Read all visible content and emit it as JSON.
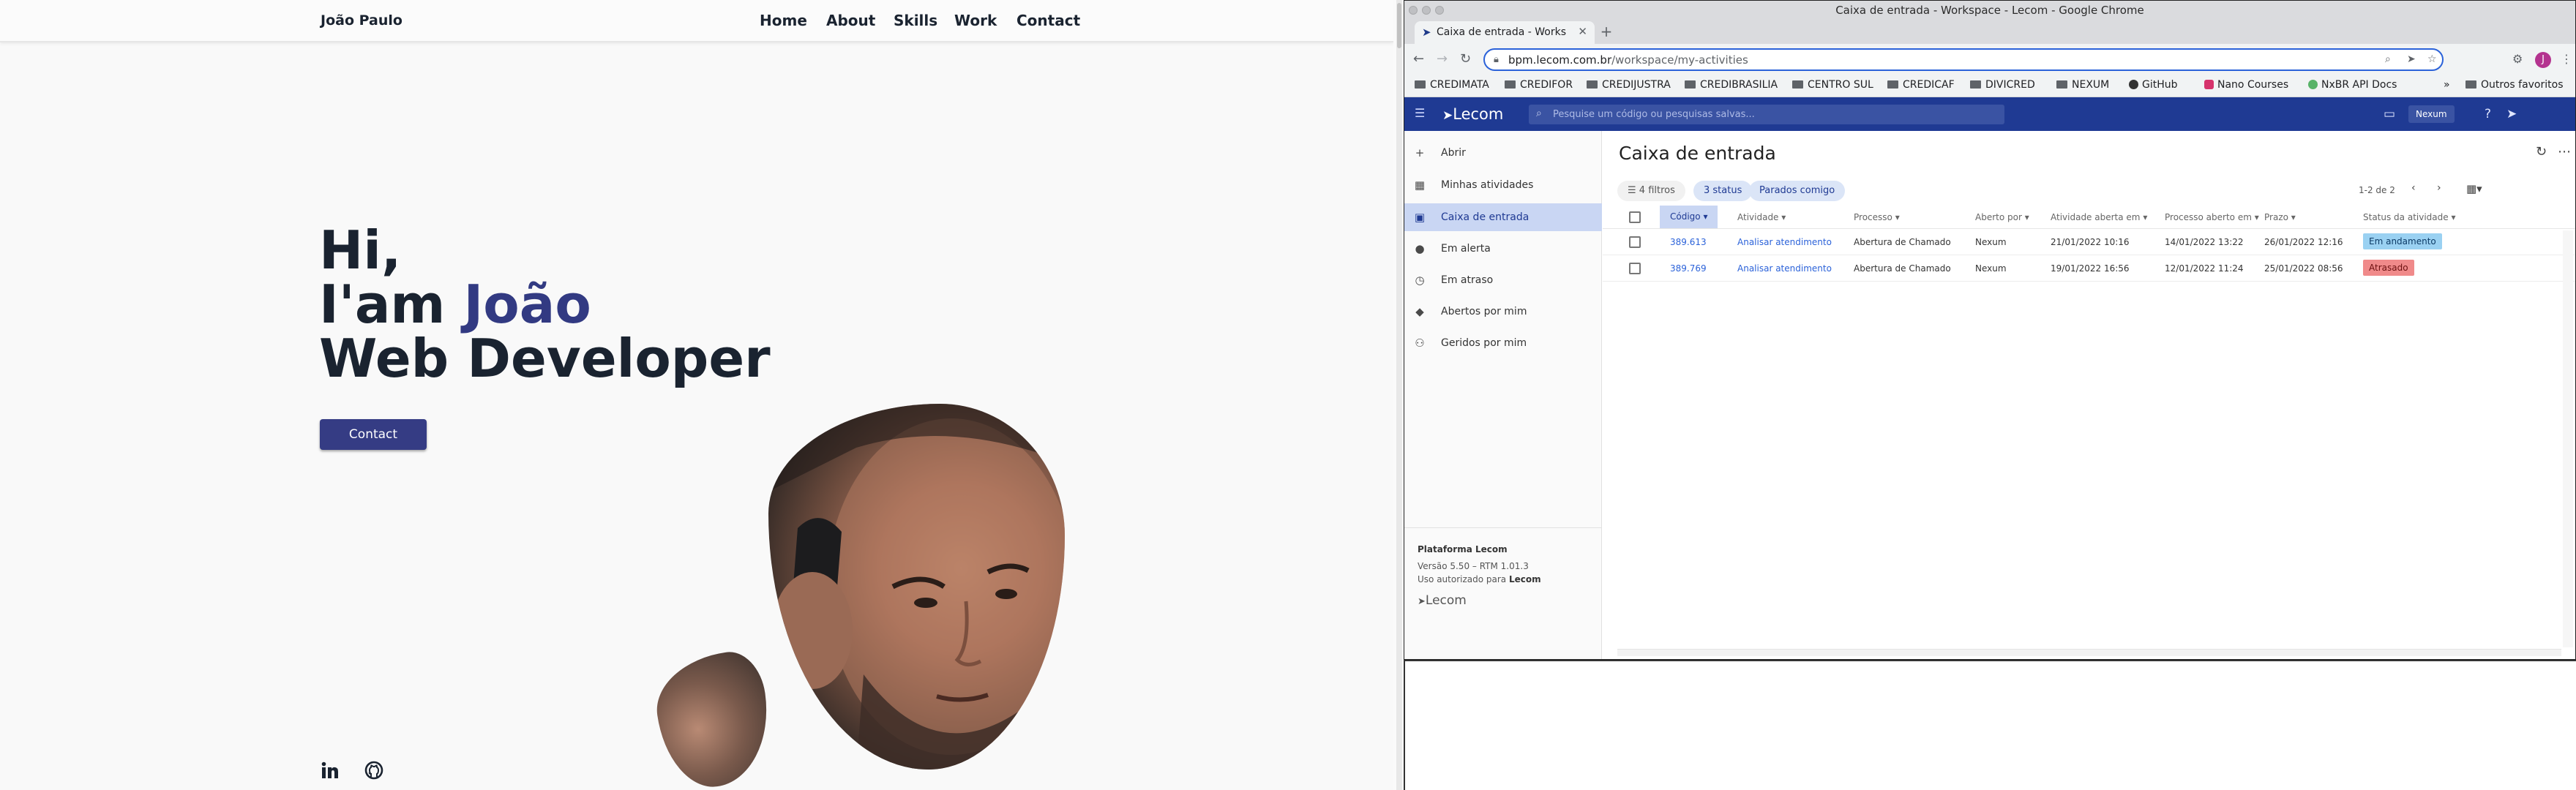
{
  "portfolio": {
    "brand": "João Paulo",
    "nav": [
      "Home",
      "About",
      "Skills",
      "Work",
      "Contact"
    ],
    "hero": {
      "line1": "Hi,",
      "line2_prefix": "I'am ",
      "line2_accent": "João",
      "line3": "Web Developer"
    },
    "cta_label": "Contact",
    "social": [
      "linkedin-icon",
      "github-icon"
    ],
    "accent_color": "#323a82"
  },
  "browser": {
    "window_title": "Caixa de entrada - Workspace - Lecom - Google Chrome",
    "tab_title": "Caixa de entrada - Worksp",
    "url_host": "bpm.lecom.com.br",
    "url_path": "/workspace/my-activities",
    "bookmarks": [
      "CREDIMATA",
      "CREDIFOR",
      "CREDIJUSTRA",
      "CREDIBRASILIA",
      "CENTRO SUL",
      "CREDICAF",
      "DIVICRED",
      "NEXUM",
      "GitHub",
      "Nano Courses",
      "NxBR API Docs"
    ],
    "bookmarks_more": "»",
    "other_bookmarks": "Outros favoritos",
    "avatar_letter": "J"
  },
  "app": {
    "logo": "Lecom",
    "search_placeholder": "Pesquise um código ou pesquisas salvas...",
    "user_chip": "Nexum",
    "sidebar": [
      {
        "label": "Abrir",
        "icon": "plus-icon",
        "active": false
      },
      {
        "label": "Minhas atividades",
        "icon": "grid-icon",
        "active": false
      },
      {
        "label": "Caixa de entrada",
        "icon": "inbox-icon",
        "active": true
      },
      {
        "label": "Em alerta",
        "icon": "alert-icon",
        "active": false
      },
      {
        "label": "Em atraso",
        "icon": "clock-icon",
        "active": false
      },
      {
        "label": "Abertos por mim",
        "icon": "tag-icon",
        "active": false
      },
      {
        "label": "Geridos por mim",
        "icon": "people-icon",
        "active": false
      }
    ],
    "footer": {
      "platform": "Plataforma Lecom",
      "version": "Versão 5.50 – RTM 1.01.3",
      "license_prefix": "Uso autorizado para ",
      "license_org": "Lecom",
      "logo": "Lecom"
    },
    "page_title": "Caixa de entrada",
    "filters": [
      "4 filtros",
      "3 status",
      "Parados comigo"
    ],
    "pager": "1-2 de 2",
    "columns": [
      "Código",
      "Atividade",
      "Processo",
      "Aberto por",
      "Atividade aberta em",
      "Processo aberto em",
      "Prazo",
      "Status da atividade"
    ],
    "rows": [
      {
        "codigo": "389.613",
        "atividade": "Analisar atendimento",
        "processo": "Abertura de Chamado",
        "aberto_por": "Nexum",
        "atividade_aberta": "21/01/2022 10:16",
        "processo_aberto": "14/01/2022 13:22",
        "prazo": "26/01/2022 12:16",
        "status": "Em andamento",
        "status_kind": "ok"
      },
      {
        "codigo": "389.769",
        "atividade": "Analisar atendimento",
        "processo": "Abertura de Chamado",
        "aberto_por": "Nexum",
        "atividade_aberta": "19/01/2022 16:56",
        "processo_aberto": "12/01/2022 11:24",
        "prazo": "25/01/2022 08:56",
        "status": "Atrasado",
        "status_kind": "late"
      }
    ]
  }
}
